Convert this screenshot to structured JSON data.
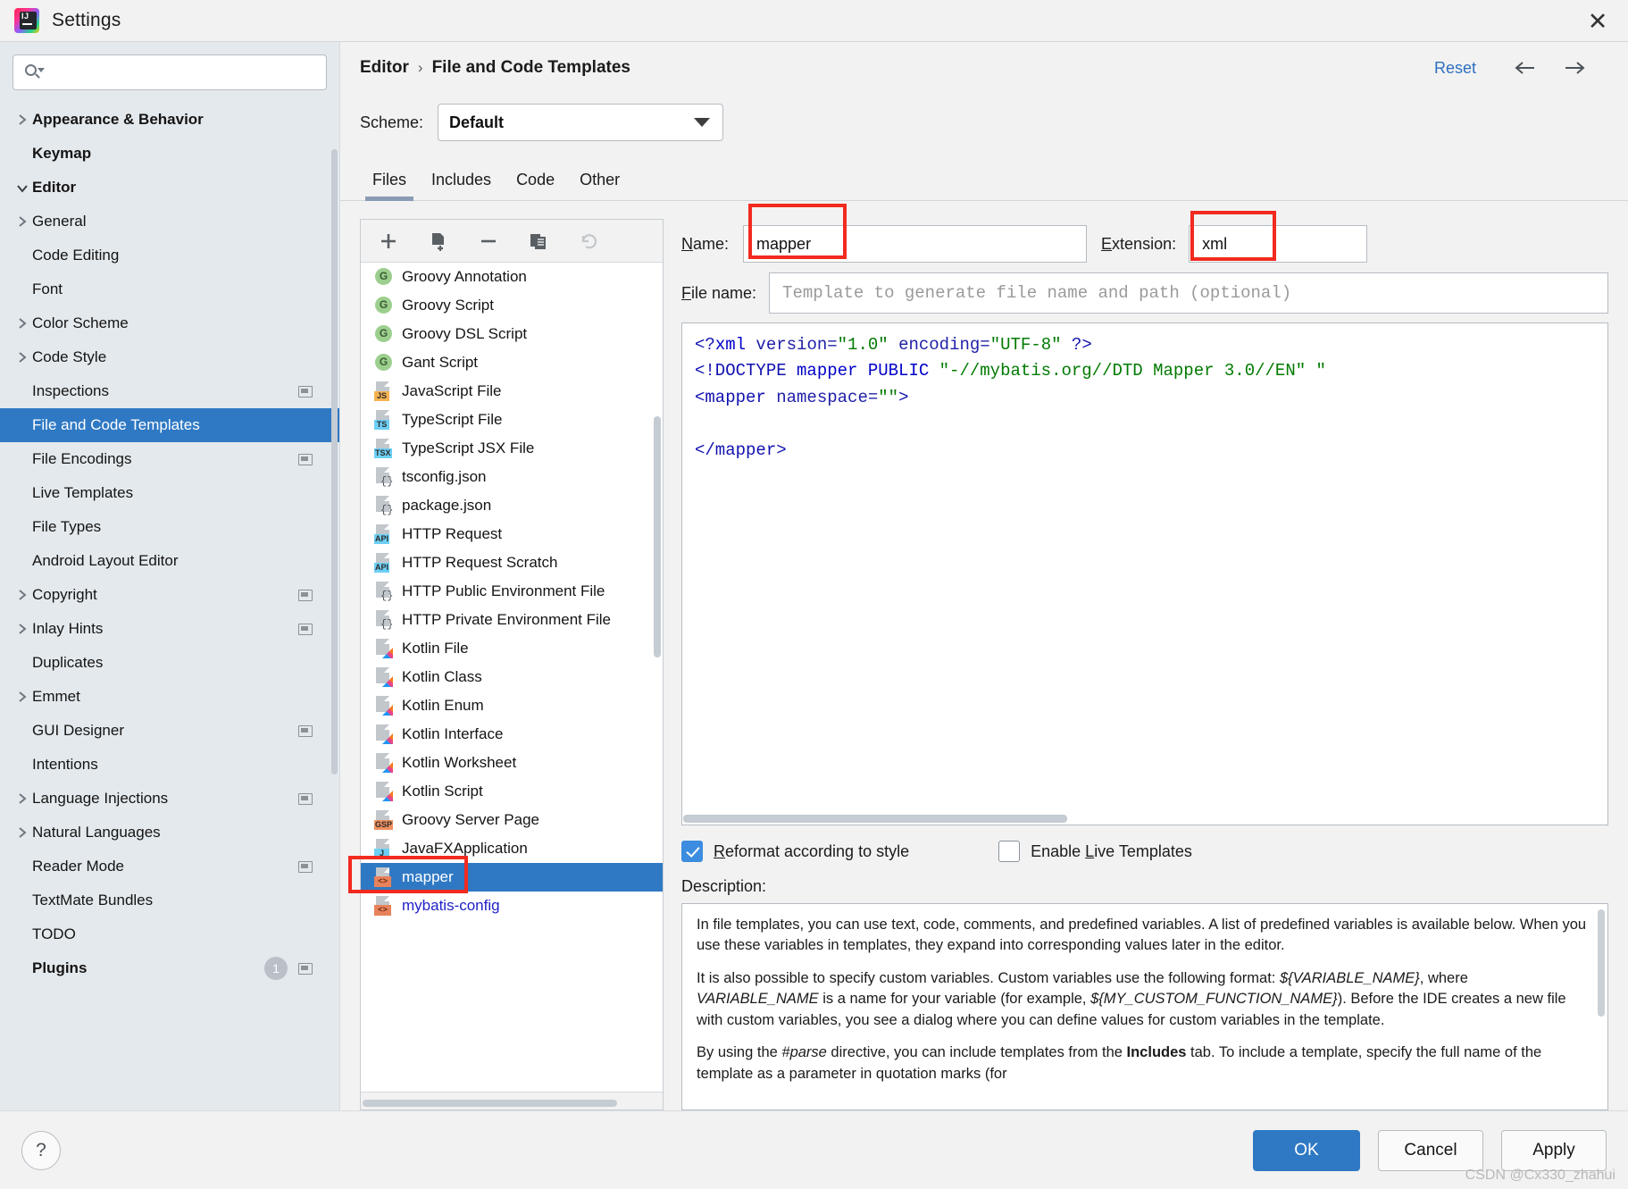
{
  "window": {
    "title": "Settings",
    "close_label": "✕",
    "logo_text": "IJ"
  },
  "sidebar": {
    "search_placeholder": "",
    "search_value": "",
    "items": [
      {
        "label": "Appearance & Behavior",
        "level": 0,
        "twisty": "right",
        "bold": true,
        "selected": false,
        "trailing": false
      },
      {
        "label": "Keymap",
        "level": 0,
        "twisty": "none",
        "bold": true,
        "selected": false,
        "trailing": false
      },
      {
        "label": "Editor",
        "level": 0,
        "twisty": "down",
        "bold": true,
        "selected": false,
        "trailing": false
      },
      {
        "label": "General",
        "level": 1,
        "twisty": "right",
        "bold": false,
        "selected": false,
        "trailing": false
      },
      {
        "label": "Code Editing",
        "level": 1,
        "twisty": "none",
        "bold": false,
        "selected": false,
        "trailing": false
      },
      {
        "label": "Font",
        "level": 1,
        "twisty": "none",
        "bold": false,
        "selected": false,
        "trailing": false
      },
      {
        "label": "Color Scheme",
        "level": 1,
        "twisty": "right",
        "bold": false,
        "selected": false,
        "trailing": false
      },
      {
        "label": "Code Style",
        "level": 1,
        "twisty": "right",
        "bold": false,
        "selected": false,
        "trailing": false
      },
      {
        "label": "Inspections",
        "level": 1,
        "twisty": "none",
        "bold": false,
        "selected": false,
        "trailing": true
      },
      {
        "label": "File and Code Templates",
        "level": 1,
        "twisty": "none",
        "bold": false,
        "selected": true,
        "trailing": false
      },
      {
        "label": "File Encodings",
        "level": 1,
        "twisty": "none",
        "bold": false,
        "selected": false,
        "trailing": true
      },
      {
        "label": "Live Templates",
        "level": 1,
        "twisty": "none",
        "bold": false,
        "selected": false,
        "trailing": false
      },
      {
        "label": "File Types",
        "level": 1,
        "twisty": "none",
        "bold": false,
        "selected": false,
        "trailing": false
      },
      {
        "label": "Android Layout Editor",
        "level": 1,
        "twisty": "none",
        "bold": false,
        "selected": false,
        "trailing": false
      },
      {
        "label": "Copyright",
        "level": 1,
        "twisty": "right",
        "bold": false,
        "selected": false,
        "trailing": true
      },
      {
        "label": "Inlay Hints",
        "level": 1,
        "twisty": "right",
        "bold": false,
        "selected": false,
        "trailing": true
      },
      {
        "label": "Duplicates",
        "level": 1,
        "twisty": "none",
        "bold": false,
        "selected": false,
        "trailing": false
      },
      {
        "label": "Emmet",
        "level": 1,
        "twisty": "right",
        "bold": false,
        "selected": false,
        "trailing": false
      },
      {
        "label": "GUI Designer",
        "level": 1,
        "twisty": "none",
        "bold": false,
        "selected": false,
        "trailing": true
      },
      {
        "label": "Intentions",
        "level": 1,
        "twisty": "none",
        "bold": false,
        "selected": false,
        "trailing": false
      },
      {
        "label": "Language Injections",
        "level": 1,
        "twisty": "right",
        "bold": false,
        "selected": false,
        "trailing": true
      },
      {
        "label": "Natural Languages",
        "level": 1,
        "twisty": "right",
        "bold": false,
        "selected": false,
        "trailing": false
      },
      {
        "label": "Reader Mode",
        "level": 1,
        "twisty": "none",
        "bold": false,
        "selected": false,
        "trailing": true
      },
      {
        "label": "TextMate Bundles",
        "level": 1,
        "twisty": "none",
        "bold": false,
        "selected": false,
        "trailing": false
      },
      {
        "label": "TODO",
        "level": 1,
        "twisty": "none",
        "bold": false,
        "selected": false,
        "trailing": false
      },
      {
        "label": "Plugins",
        "level": 0,
        "twisty": "none",
        "bold": true,
        "selected": false,
        "trailing": true,
        "badge": "1"
      }
    ]
  },
  "header": {
    "breadcrumb_root": "Editor",
    "breadcrumb_sep": "›",
    "breadcrumb_leaf": "File and Code Templates",
    "reset_label": "Reset",
    "back_arrow": "←",
    "forward_arrow": "→"
  },
  "scheme": {
    "label": "Scheme:",
    "value": "Default"
  },
  "tabs": [
    {
      "label": "Files",
      "active": true
    },
    {
      "label": "Includes",
      "active": false
    },
    {
      "label": "Code",
      "active": false
    },
    {
      "label": "Other",
      "active": false
    }
  ],
  "list_toolbar": {
    "add": "add-icon",
    "copy_template": "copy-template-icon",
    "remove": "remove-icon",
    "duplicate": "duplicate-icon",
    "reset": "reset-icon"
  },
  "templates": [
    {
      "label": "Groovy Annotation",
      "icon": "groovy",
      "tag": "G",
      "selected": false
    },
    {
      "label": "Groovy Script",
      "icon": "groovy",
      "tag": "G",
      "selected": false
    },
    {
      "label": "Groovy DSL Script",
      "icon": "groovy",
      "tag": "G",
      "selected": false
    },
    {
      "label": "Gant Script",
      "icon": "groovy",
      "tag": "G",
      "selected": false
    },
    {
      "label": "JavaScript File",
      "icon": "file-tag",
      "tag": "JS",
      "color": "#f5b352",
      "selected": false
    },
    {
      "label": "TypeScript File",
      "icon": "file-tag",
      "tag": "TS",
      "color": "#6dcff6",
      "selected": false
    },
    {
      "label": "TypeScript JSX File",
      "icon": "file-tag",
      "tag": "TSX",
      "color": "#6dcff6",
      "selected": false
    },
    {
      "label": "tsconfig.json",
      "icon": "json",
      "tag": "{}",
      "selected": false
    },
    {
      "label": "package.json",
      "icon": "json",
      "tag": "{}",
      "selected": false
    },
    {
      "label": "HTTP Request",
      "icon": "file-tag",
      "tag": "API",
      "color": "#6dcff6",
      "selected": false
    },
    {
      "label": "HTTP Request Scratch",
      "icon": "file-tag",
      "tag": "API",
      "color": "#6dcff6",
      "selected": false
    },
    {
      "label": "HTTP Public Environment File",
      "icon": "json",
      "tag": "{}",
      "selected": false
    },
    {
      "label": "HTTP Private Environment File",
      "icon": "json",
      "tag": "{}",
      "selected": false
    },
    {
      "label": "Kotlin File",
      "icon": "kotlin",
      "tag": "",
      "selected": false
    },
    {
      "label": "Kotlin Class",
      "icon": "kotlin",
      "tag": "",
      "selected": false
    },
    {
      "label": "Kotlin Enum",
      "icon": "kotlin",
      "tag": "",
      "selected": false
    },
    {
      "label": "Kotlin Interface",
      "icon": "kotlin",
      "tag": "",
      "selected": false
    },
    {
      "label": "Kotlin Worksheet",
      "icon": "kotlin",
      "tag": "",
      "selected": false
    },
    {
      "label": "Kotlin Script",
      "icon": "kotlin",
      "tag": "",
      "selected": false
    },
    {
      "label": "Groovy Server Page",
      "icon": "file-tag",
      "tag": "GSP",
      "color": "#f09060",
      "selected": false
    },
    {
      "label": "JavaFXApplication",
      "icon": "file-tag",
      "tag": "J",
      "color": "#6dcff6",
      "selected": false
    },
    {
      "label": "mapper",
      "icon": "xml",
      "tag": "<>",
      "selected": true
    },
    {
      "label": "mybatis-config",
      "icon": "xml",
      "tag": "<>",
      "selected": false,
      "blue_text": true
    }
  ],
  "form": {
    "name_label": "Name:",
    "name_value": "mapper",
    "extension_label": "Extension:",
    "extension_value": "xml",
    "filename_label": "File name:",
    "filename_placeholder": "Template to generate file name and path (optional)",
    "filename_value": ""
  },
  "code": {
    "line1_a": "<?",
    "line1_b": "xml",
    "line1_c": " version=",
    "line1_d": "\"1.0\"",
    "line1_e": " encoding=",
    "line1_f": "\"UTF-8\"",
    "line1_g": " ?>",
    "line2_a": "<!DOCTYPE",
    "line2_b": " mapper PUBLIC ",
    "line2_c": "\"-//mybatis.org//DTD Mapper 3.0//EN\"",
    "line2_d": " \"",
    "line3_a": "<mapper",
    "line3_b": " namespace=",
    "line3_c": "\"\"",
    "line3_d": ">",
    "line4": "",
    "line5": "</mapper>"
  },
  "options": {
    "reformat_label": "Reformat according to style",
    "reformat_checked": true,
    "live_templates_label": "Enable Live Templates",
    "live_templates_checked": false
  },
  "description": {
    "label": "Description:",
    "p1": "In file templates, you can use text, code, comments, and predefined variables. A list of predefined variables is available below. When you use these variables in templates, they expand into corresponding values later in the editor.",
    "p2_pre": "It is also possible to specify custom variables. Custom variables use the following format: ",
    "p2_var1": "${VARIABLE_NAME}",
    "p2_mid1": ", where ",
    "p2_var2": "VARIABLE_NAME",
    "p2_mid2": " is a name for your variable (for example, ",
    "p2_var3": "${MY_CUSTOM_FUNCTION_NAME}",
    "p2_post": "). Before the IDE creates a new file with custom variables, you see a dialog where you can define values for custom variables in the template.",
    "p3_pre": "By using the ",
    "p3_directive": "#parse",
    "p3_mid": " directive, you can include templates from the ",
    "p3_tab": "Includes",
    "p3_post": " tab. To include a template, specify the full name of the template as a parameter in quotation marks (for"
  },
  "footer": {
    "help_label": "?",
    "ok_label": "OK",
    "cancel_label": "Cancel",
    "apply_label": "Apply"
  },
  "watermark": "CSDN @Cx330_zhahui"
}
